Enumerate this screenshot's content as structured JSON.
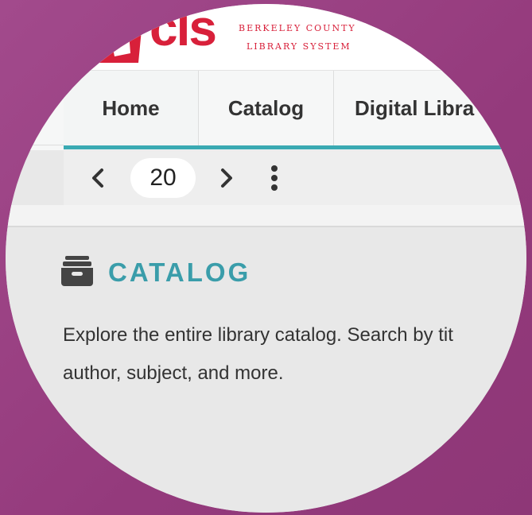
{
  "brand": {
    "logo_text": "cls",
    "tagline_line1": "Berkeley County",
    "tagline_line2": "Library System",
    "brand_color": "#d8203a"
  },
  "tabs": [
    {
      "label": "Home",
      "active": true
    },
    {
      "label": "Catalog",
      "active": false
    },
    {
      "label": "Digital Libra",
      "active": false
    }
  ],
  "toolbar": {
    "prev_icon": "chevron-left-icon",
    "page_number": "20",
    "next_icon": "chevron-right-icon",
    "more_icon": "more-vertical-icon"
  },
  "section": {
    "icon": "archive-box-icon",
    "title": "CATALOG",
    "title_color": "#3a9daa",
    "description_line1": "Explore the entire library catalog. Search by tit",
    "description_line2": "author, subject, and more."
  },
  "accent_color": "#3aaab3",
  "background_color": "#9a3f82"
}
